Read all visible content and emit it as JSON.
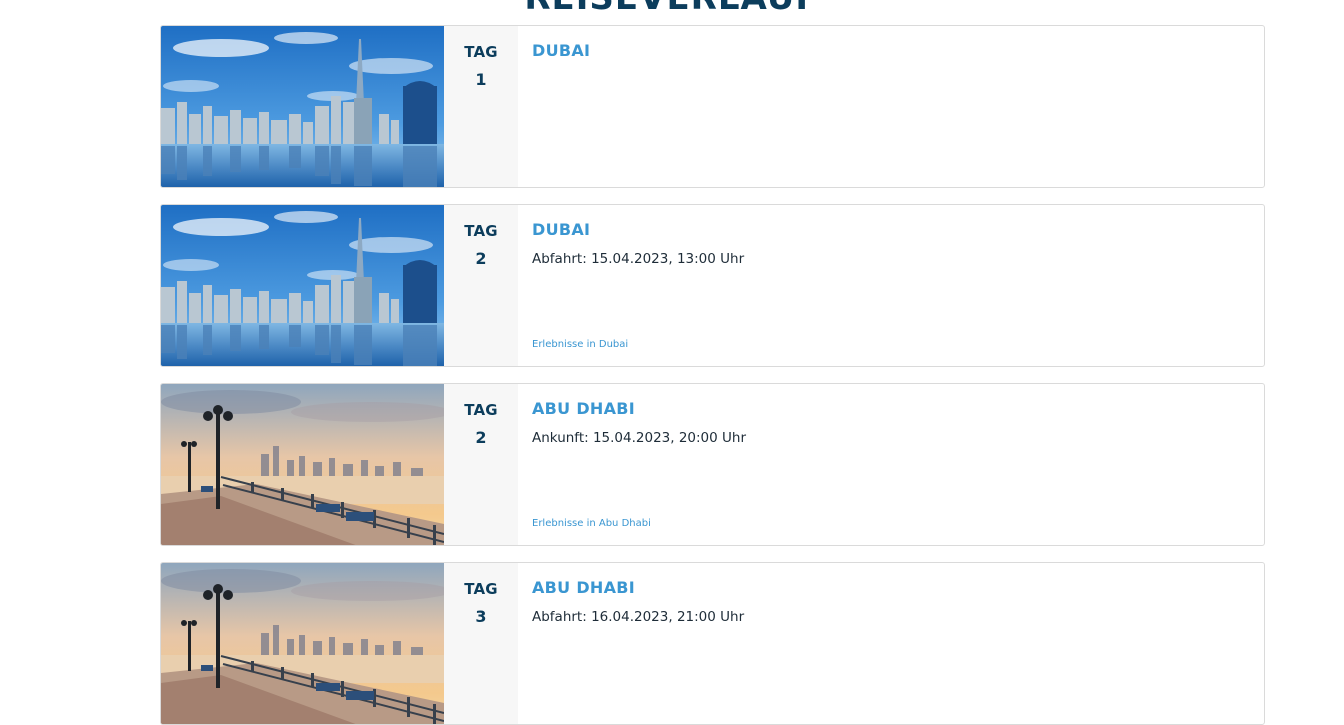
{
  "page": {
    "heading": "REISEVERLAUF"
  },
  "colors": {
    "accent": "#3a96d1",
    "heading": "#0c3d5c",
    "day_panel": "#f7f7f7",
    "card_border": "#dadada"
  },
  "itinerary": [
    {
      "image": "dubai-skyline-image",
      "day_word": "TAG",
      "day_number": "1",
      "place": "DUBAI",
      "time_text": "",
      "link_text": ""
    },
    {
      "image": "dubai-skyline-image",
      "day_word": "TAG",
      "day_number": "2",
      "place": "DUBAI",
      "time_text": "Abfahrt: 15.04.2023, 13:00 Uhr",
      "link_text": "Erlebnisse in Dubai"
    },
    {
      "image": "abu-dhabi-corniche-image",
      "day_word": "TAG",
      "day_number": "2",
      "place": "ABU DHABI",
      "time_text": "Ankunft: 15.04.2023, 20:00 Uhr",
      "link_text": "Erlebnisse in Abu Dhabi"
    },
    {
      "image": "abu-dhabi-corniche-image",
      "day_word": "TAG",
      "day_number": "3",
      "place": "ABU DHABI",
      "time_text": "Abfahrt: 16.04.2023, 21:00 Uhr",
      "link_text": ""
    }
  ]
}
